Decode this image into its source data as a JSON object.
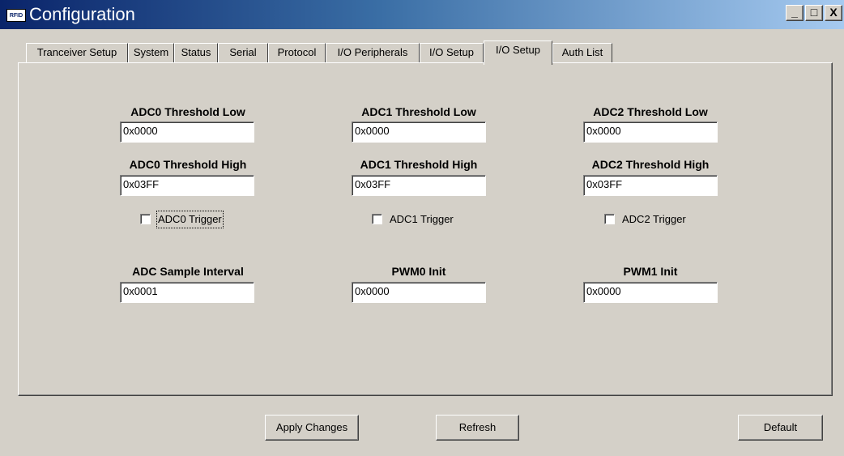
{
  "window": {
    "title": "Configuration",
    "icon_text": "RFID",
    "controls": {
      "minimize": "_",
      "maximize": "□",
      "close": "X"
    }
  },
  "tabs": [
    {
      "label": "Tranceiver Setup"
    },
    {
      "label": "System"
    },
    {
      "label": "Status"
    },
    {
      "label": "Serial"
    },
    {
      "label": "Protocol"
    },
    {
      "label": "I/O Peripherals"
    },
    {
      "label": "I/O Setup"
    },
    {
      "label": "I/O Setup",
      "active": true
    },
    {
      "label": "Auth List"
    }
  ],
  "fields": {
    "adc0_low": {
      "label": "ADC0 Threshold Low",
      "value": "0x0000"
    },
    "adc1_low": {
      "label": "ADC1 Threshold Low",
      "value": "0x0000"
    },
    "adc2_low": {
      "label": "ADC2 Threshold Low",
      "value": "0x0000"
    },
    "adc0_high": {
      "label": "ADC0 Threshold High",
      "value": "0x03FF"
    },
    "adc1_high": {
      "label": "ADC1 Threshold High",
      "value": "0x03FF"
    },
    "adc2_high": {
      "label": "ADC2 Threshold High",
      "value": "0x03FF"
    },
    "sample_interval": {
      "label": "ADC Sample Interval",
      "value": "0x0001"
    },
    "pwm0": {
      "label": "PWM0 Init",
      "value": "0x0000"
    },
    "pwm1": {
      "label": "PWM1 Init",
      "value": "0x0000"
    }
  },
  "triggers": {
    "adc0": {
      "label": "ADC0 Trigger",
      "checked": false
    },
    "adc1": {
      "label": "ADC1 Trigger",
      "checked": false
    },
    "adc2": {
      "label": "ADC2 Trigger",
      "checked": false
    }
  },
  "buttons": {
    "apply": "Apply Changes",
    "refresh": "Refresh",
    "default": "Default"
  }
}
